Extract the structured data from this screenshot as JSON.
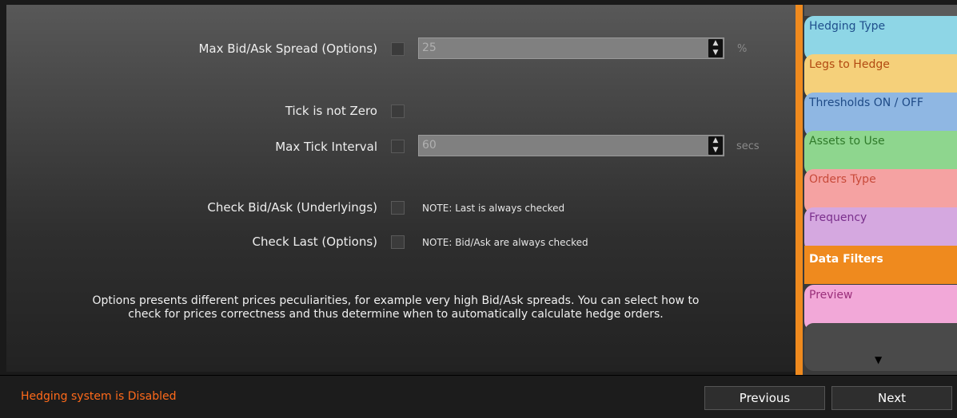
{
  "filters": {
    "max_spread": {
      "label": "Max Bid/Ask Spread (Options)",
      "value": "25",
      "unit": "%"
    },
    "tick_not_zero": {
      "label": "Tick is not Zero"
    },
    "max_tick": {
      "label": "Max Tick Interval",
      "value": "60",
      "unit": "secs"
    },
    "check_bidask": {
      "label": "Check Bid/Ask (Underlyings)",
      "note": "NOTE: Last is always checked"
    },
    "check_last": {
      "label": "Check Last (Options)",
      "note": "NOTE: Bid/Ask are always checked"
    }
  },
  "description": "Options presents different prices peculiarities, for example very high Bid/Ask spreads. You can select how to check for prices correctness and thus determine when to automatically calculate hedge orders.",
  "sidebar": {
    "tabs": [
      {
        "label": "Hedging Type",
        "bg": "#8ed6e6",
        "color": "#1f4f8c"
      },
      {
        "label": "Legs to Hedge",
        "bg": "#f5d07a",
        "color": "#b24a12"
      },
      {
        "label": "Thresholds ON / OFF",
        "bg": "#8fb7e3",
        "color": "#1e4a86"
      },
      {
        "label": "Assets to Use",
        "bg": "#8ed68e",
        "color": "#2f7a2a"
      },
      {
        "label": "Orders Type",
        "bg": "#f5a2a2",
        "color": "#c84a3a"
      },
      {
        "label": "Frequency",
        "bg": "#d5a8e0",
        "color": "#7a2f8c"
      },
      {
        "label": "Data Filters",
        "bg": "#ef8a1e",
        "color": "#ffffff"
      },
      {
        "label": "Preview",
        "bg": "#f2a8d8",
        "color": "#9a2f7a"
      }
    ],
    "scroll_arrow": "▼"
  },
  "footer": {
    "status": "Hedging system is Disabled",
    "previous_label": "Previous",
    "next_label": "Next"
  },
  "icons": {
    "spinner_up": "▲",
    "spinner_down": "▼"
  }
}
